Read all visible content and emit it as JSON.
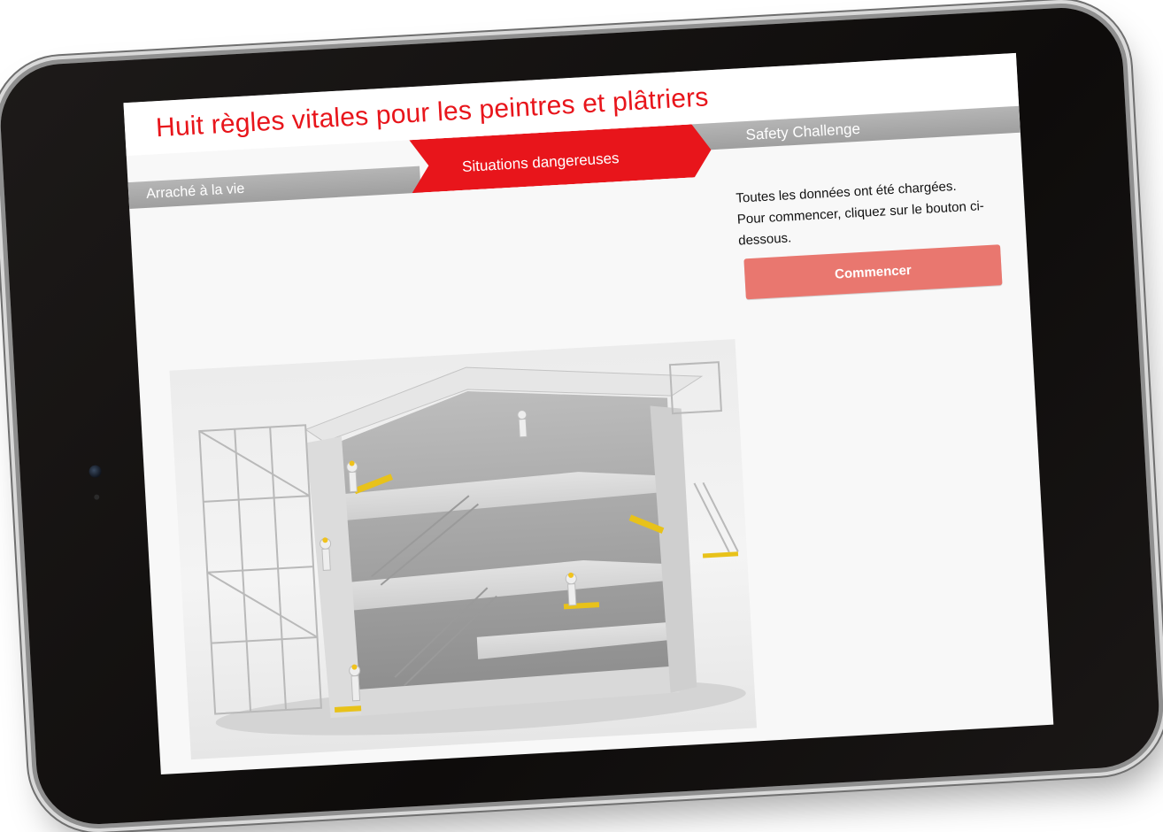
{
  "app": {
    "title": "Huit règles vitales pour les peintres et plâtriers"
  },
  "nav": {
    "steps": [
      {
        "label": "Arraché à la vie"
      },
      {
        "label": "Situations dangereuses"
      },
      {
        "label": "Safety Challenge"
      }
    ],
    "active_index": 1
  },
  "content": {
    "intro_line1": "Toutes les données ont été chargées.",
    "intro_line2": "Pour commencer, cliquez sur le bouton ci-dessous.",
    "start_label": "Commencer"
  },
  "colors": {
    "brand_red": "#e8151b",
    "button_red": "#e9776f",
    "nav_gray": "#a8a8a8",
    "frame": "#141110"
  }
}
